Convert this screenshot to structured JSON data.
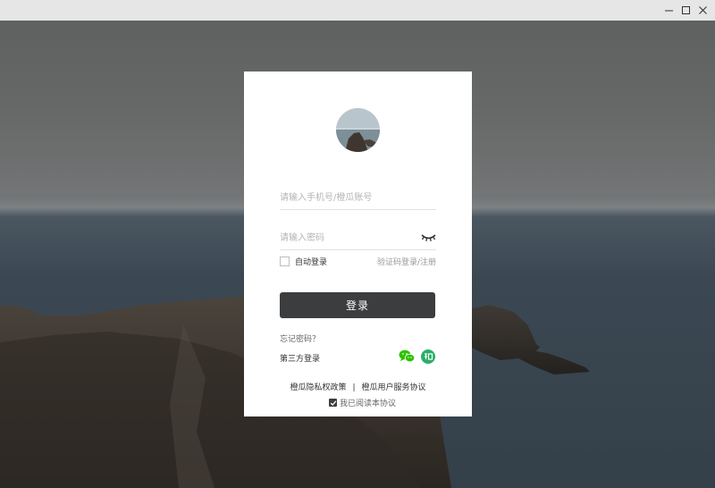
{
  "window": {
    "minimize_icon": "minimize-icon",
    "maximize_icon": "maximize-icon",
    "close_icon": "close-icon"
  },
  "login": {
    "account_placeholder": "请输入手机号/橙瓜账号",
    "password_placeholder": "请输入密码",
    "auto_login_label": "自动登录",
    "sms_login_link": "验证码登录/注册",
    "login_button": "登录",
    "forgot_password": "忘记密码？",
    "third_party_label": "第三方登录",
    "privacy_policy": "橙瓜隐私权政策",
    "separator": "|",
    "user_agreement": "橙瓜用户服务协议",
    "agreement_checkbox_label": "我已阅读本协议",
    "auto_login_checked": false,
    "agreement_checked": true
  },
  "colors": {
    "button_bg": "#3c3d3f",
    "wechat": "#2dc100",
    "chengzi": "#2aae67"
  }
}
